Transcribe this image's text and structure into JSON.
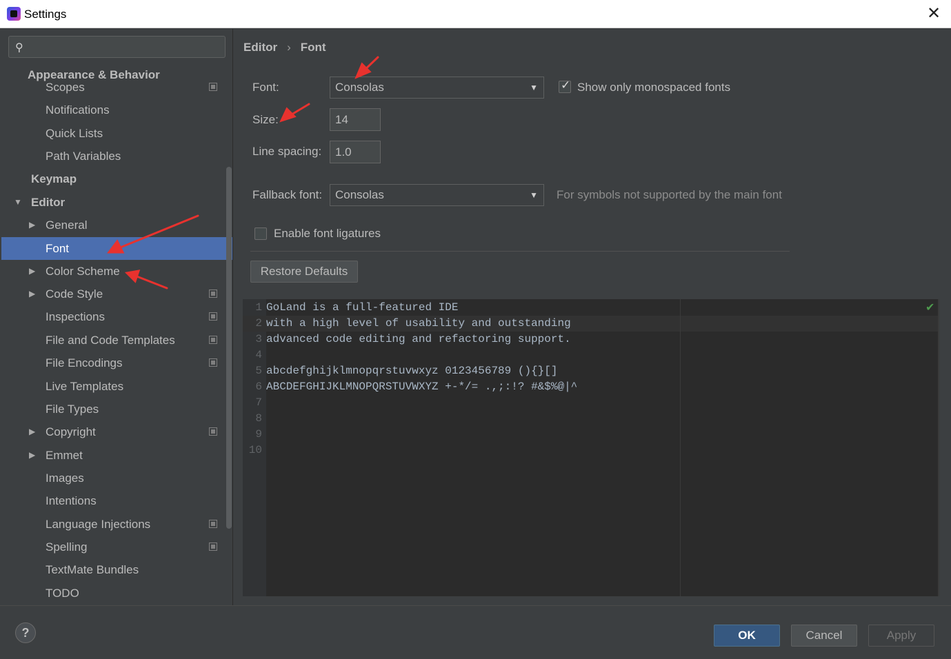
{
  "window": {
    "title": "Settings",
    "close_glyph": "✕"
  },
  "search": {
    "icon": "🔍"
  },
  "sidebar": {
    "items": [
      {
        "label": "Appearance & Behavior"
      },
      {
        "label": "Scopes"
      },
      {
        "label": "Notifications"
      },
      {
        "label": "Quick Lists"
      },
      {
        "label": "Path Variables"
      },
      {
        "label": "Keymap"
      },
      {
        "label": "Editor"
      },
      {
        "label": "General"
      },
      {
        "label": "Font"
      },
      {
        "label": "Color Scheme"
      },
      {
        "label": "Code Style"
      },
      {
        "label": "Inspections"
      },
      {
        "label": "File and Code Templates"
      },
      {
        "label": "File Encodings"
      },
      {
        "label": "Live Templates"
      },
      {
        "label": "File Types"
      },
      {
        "label": "Copyright"
      },
      {
        "label": "Emmet"
      },
      {
        "label": "Images"
      },
      {
        "label": "Intentions"
      },
      {
        "label": "Language Injections"
      },
      {
        "label": "Spelling"
      },
      {
        "label": "TextMate Bundles"
      },
      {
        "label": "TODO"
      }
    ]
  },
  "breadcrumb": {
    "parent": "Editor",
    "separator": "›",
    "current": "Font"
  },
  "form": {
    "font_label": "Font:",
    "font_value": "Consolas",
    "show_mono_label": "Show only monospaced fonts",
    "show_mono_checked": true,
    "size_label": "Size:",
    "size_value": "14",
    "line_spacing_label": "Line spacing:",
    "line_spacing_value": "1.0",
    "fallback_label": "Fallback font:",
    "fallback_value": "Consolas",
    "fallback_hint": "For symbols not supported by the main font",
    "ligatures_label": "Enable font ligatures",
    "ligatures_checked": false,
    "restore_label": "Restore Defaults"
  },
  "preview": {
    "lines": [
      {
        "n": "1",
        "text": "GoLand is a full-featured IDE"
      },
      {
        "n": "2",
        "text": "with a high level of usability and outstanding"
      },
      {
        "n": "3",
        "text": "advanced code editing and refactoring support."
      },
      {
        "n": "4",
        "text": ""
      },
      {
        "n": "5",
        "text": "abcdefghijklmnopqrstuvwxyz 0123456789 (){}[]"
      },
      {
        "n": "6",
        "text": "ABCDEFGHIJKLMNOPQRSTUVWXYZ +-*/= .,;:!? #&$%@|^"
      },
      {
        "n": "7",
        "text": ""
      },
      {
        "n": "8",
        "text": ""
      },
      {
        "n": "9",
        "text": ""
      },
      {
        "n": "10",
        "text": ""
      }
    ]
  },
  "buttons": {
    "help": "?",
    "ok": "OK",
    "cancel": "Cancel",
    "apply": "Apply"
  },
  "colors": {
    "selection": "#4b6eaf",
    "ok_button": "#365880",
    "annotation": "#e8322e"
  }
}
